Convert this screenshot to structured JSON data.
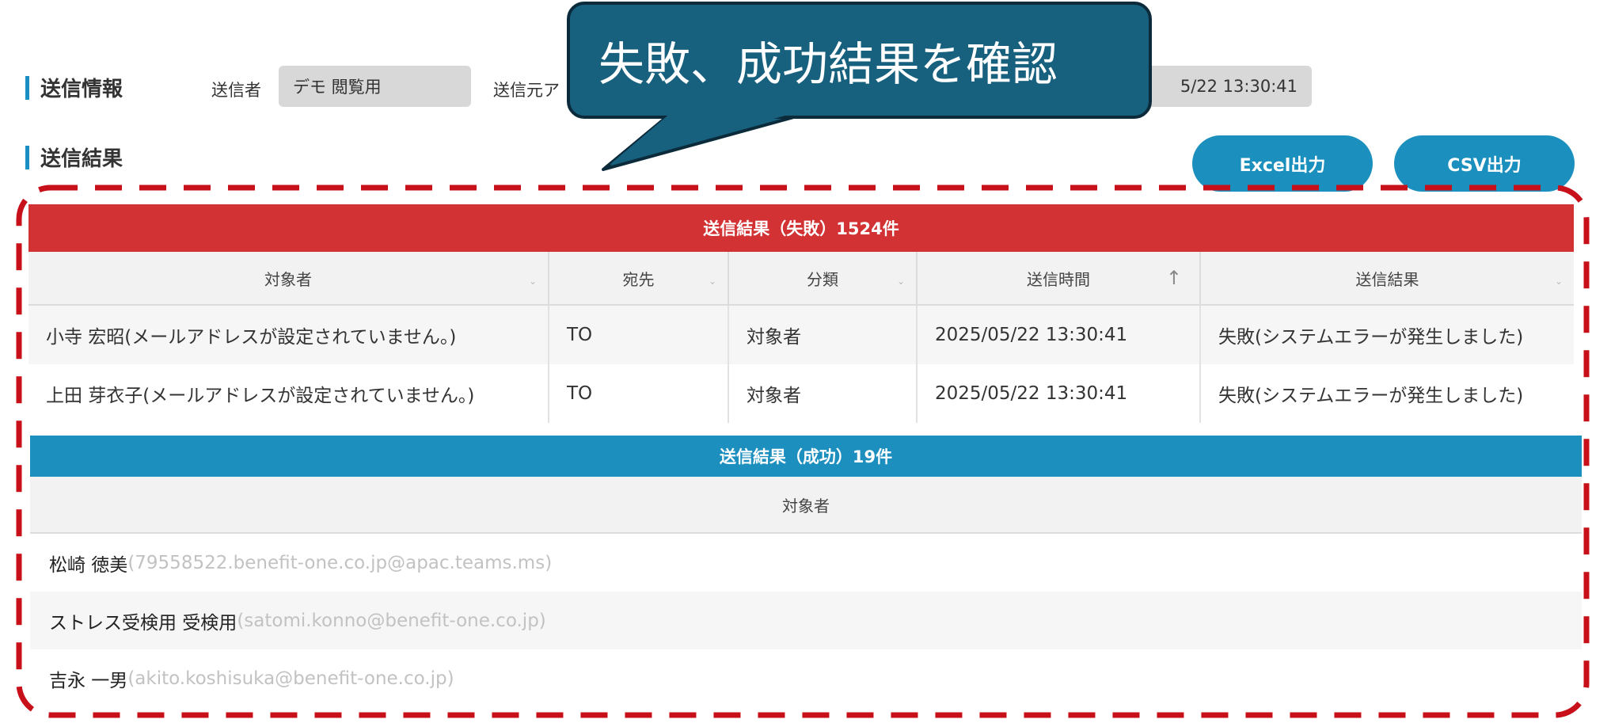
{
  "send_info": {
    "heading": "送信情報",
    "sender_label": "送信者",
    "sender_value": "デモ 閲覧用",
    "source_label": "送信元ア",
    "datetime_value": "5/22 13:30:41"
  },
  "send_result": {
    "heading": "送信結果",
    "excel_button": "Excel出力",
    "csv_button": "CSV出力"
  },
  "callout": {
    "text": "失敗、成功結果を確認"
  },
  "fail_table": {
    "title": "送信結果（失敗）1524件",
    "headers": [
      "対象者",
      "宛先",
      "分類",
      "送信時間",
      "送信結果"
    ],
    "sort_indicator": "↑",
    "rows": [
      {
        "target": "小寺 宏昭(メールアドレスが設定されていません。)",
        "to": "TO",
        "category": "対象者",
        "time": "2025/05/22 13:30:41",
        "result": "失敗(システムエラーが発生しました)"
      },
      {
        "target": "上田 芽衣子(メールアドレスが設定されていません。)",
        "to": "TO",
        "category": "対象者",
        "time": "2025/05/22 13:30:41",
        "result": "失敗(システムエラーが発生しました)"
      }
    ]
  },
  "success_table": {
    "title": "送信結果（成功）19件",
    "header": "対象者",
    "rows": [
      {
        "name": "松崎 徳美",
        "email": "(79558522.benefit-one.co.jp@apac.teams.ms)"
      },
      {
        "name": "ストレス受検用 受検用",
        "email": "(satomi.konno@benefit-one.co.jp)"
      },
      {
        "name": "吉永 一男",
        "email": "(akito.koshisuka@benefit-one.co.jp)"
      }
    ]
  },
  "colors": {
    "fail": "#d23233",
    "success": "#1d8fbf",
    "button": "#1b8fbd",
    "callout": "#17607e",
    "highlight_dash": "#c8101a"
  }
}
